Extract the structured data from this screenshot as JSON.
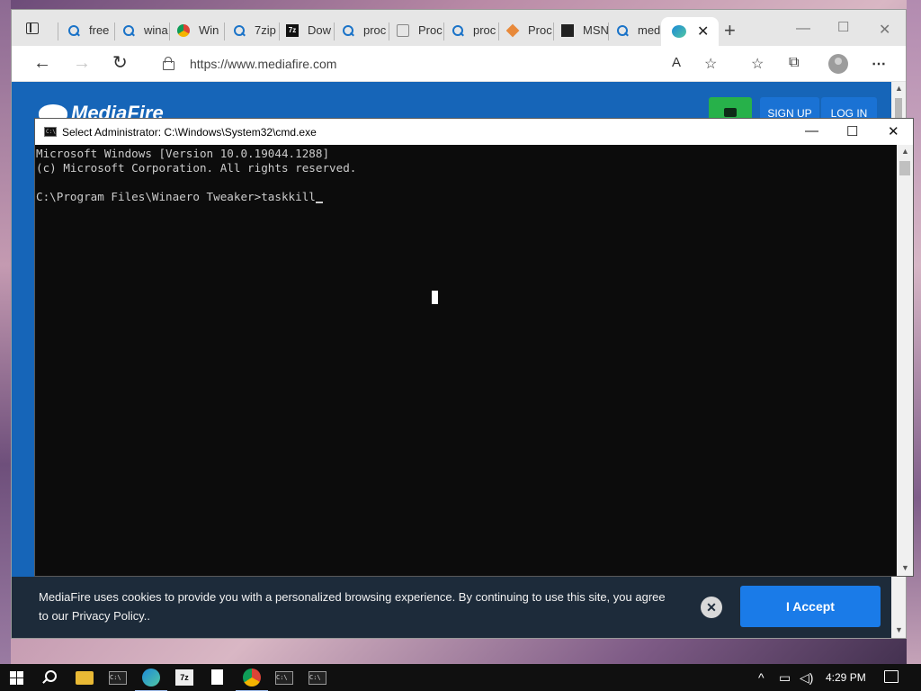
{
  "browser": {
    "tabs": [
      {
        "label": "free",
        "icon": "search-icon"
      },
      {
        "label": "wina",
        "icon": "search-icon"
      },
      {
        "label": "Win",
        "icon": "chrome-icon"
      },
      {
        "label": "7zip",
        "icon": "search-icon"
      },
      {
        "label": "Dow",
        "icon": "7zip-icon"
      },
      {
        "label": "proc",
        "icon": "search-icon"
      },
      {
        "label": "Proc",
        "icon": "document-icon"
      },
      {
        "label": "proc",
        "icon": "search-icon"
      },
      {
        "label": "Proc",
        "icon": "diamond-icon"
      },
      {
        "label": "MSN",
        "icon": "msn-icon"
      },
      {
        "label": "med",
        "icon": "search-icon"
      }
    ],
    "active_tab_icon": "edge-icon",
    "url": "https://www.mediafire.com",
    "accent_color": "#1665b8"
  },
  "mediafire": {
    "logo": "MediaFire",
    "signup": "SIGN UP",
    "login": "LOG IN"
  },
  "cookie_banner": {
    "text": "MediaFire uses cookies to provide you with a personalized browsing experience. By continuing to use this site, you agree to our Privacy Policy..",
    "accept": "I Accept",
    "close": "✕"
  },
  "cmd": {
    "title": "Select Administrator: C:\\Windows\\System32\\cmd.exe",
    "line1": "Microsoft Windows [Version 10.0.19044.1288]",
    "line2": "(c) Microsoft Corporation. All rights reserved.",
    "prompt": "C:\\Program Files\\Winaero Tweaker>",
    "typed": "taskkill"
  },
  "taskbar": {
    "clock": "4:29 PM",
    "apps": [
      "file-explorer-icon",
      "cmd-icon",
      "edge-icon",
      "7zip-icon",
      "file-icon",
      "chrome-icon",
      "cmd-icon",
      "cmd-icon"
    ]
  }
}
